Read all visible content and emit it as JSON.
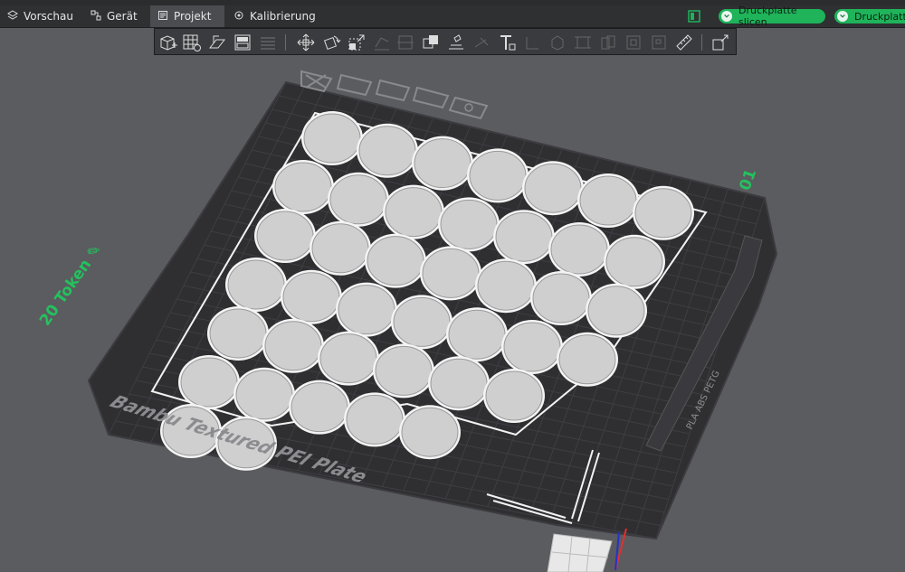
{
  "tabs": [
    {
      "label": "Vorschau",
      "icon": "layers-icon",
      "active": false
    },
    {
      "label": "Gerät",
      "icon": "device-icon",
      "active": false
    },
    {
      "label": "Projekt",
      "icon": "project-icon",
      "active": true
    },
    {
      "label": "Kalibrierung",
      "icon": "calibration-icon",
      "active": false
    }
  ],
  "actions": {
    "slice_plate": "Druckplatte slicen",
    "print_plate": "Druckplatte"
  },
  "scene": {
    "plate_name": "Bambu Textured PEI Plate",
    "object_name": "20 Token",
    "plate_number": "01",
    "plate_material_text": "PLA ABS PETG",
    "token_count": 41
  },
  "colors": {
    "accent": "#1fb35a",
    "label_green": "#24c15e",
    "background": "#5b5c5f",
    "plate": "#2e2e31",
    "token": "#cfcfcf"
  }
}
